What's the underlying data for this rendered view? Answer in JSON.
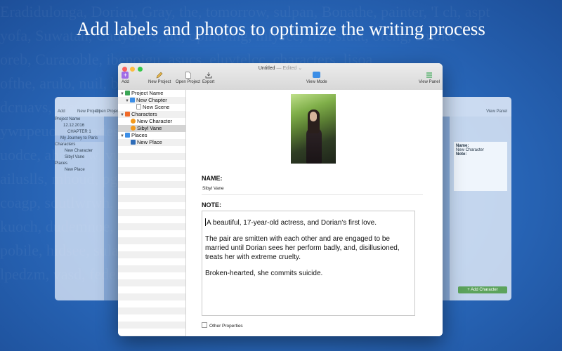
{
  "headline": "Add labels and photos to optimize the writing process",
  "colors": {
    "accent_green": "#3aa655",
    "accent_blue": "#3c8ee6",
    "accent_orange": "#f39a1e",
    "add_purple": "#a06ce6"
  },
  "window": {
    "title": "Untitled",
    "edited": "— Edited ⌄",
    "toolbar": {
      "add": "Add",
      "new_project": "New Project",
      "open_project": "Open Project",
      "export": "Export",
      "view_mode": "View Mode",
      "view_panel": "View Panel"
    }
  },
  "sidebar": {
    "project": "Project Name",
    "chapter": "New Chapter",
    "scene": "New Scene",
    "characters": "Characters",
    "character1": "New Character",
    "character2": "Sibyl Vane",
    "places": "Places",
    "place1": "New Place"
  },
  "detail": {
    "name_label": "NAME:",
    "name_value": "Sibyl Vane",
    "note_label": "NOTE:",
    "note_p1": "A beautiful, 17-year-old actress, and Dorian's first love.",
    "note_p2": "The pair are smitten with each other and are engaged to be married until Dorian sees her perform badly, and, disillusioned, treats her with extreme cruelty.",
    "note_p3": "Broken-hearted, she commits suicide.",
    "other_properties": "Other Properties"
  },
  "back_window": {
    "toolbar": {
      "add": "Add",
      "new_project": "New Project",
      "open_project": "Open Project",
      "view_panel": "View Panel"
    },
    "sidebar": {
      "project": "Project Name",
      "date": "12.12.2016",
      "chapter": "CHAPTER 1",
      "journey": "My Journey to Paris",
      "characters": "Characters",
      "character1": "New Character",
      "character2": "Sibyl Vane",
      "places": "Places",
      "place1": "New Place"
    },
    "card": {
      "name_label": "Name:",
      "name_value": "New Character",
      "note_label": "Note:"
    },
    "add_character": "+ Add Character"
  }
}
